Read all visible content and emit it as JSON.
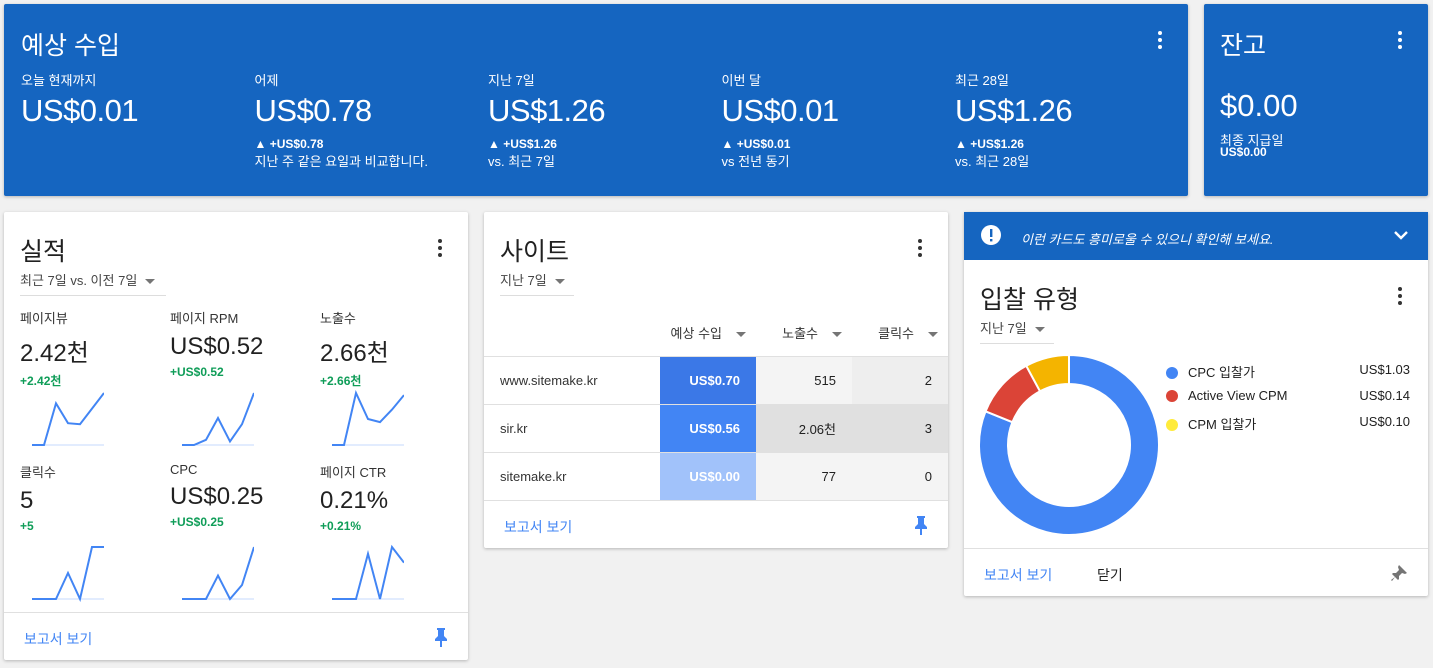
{
  "earnings": {
    "title": "예상 수입",
    "stats": [
      {
        "label": "오늘 현재까지",
        "value": "US$0.01",
        "delta": "",
        "sub": ""
      },
      {
        "label": "어제",
        "value": "US$0.78",
        "delta": "▲ +US$0.78",
        "sub": "지난 주 같은 요일과 비교합니다."
      },
      {
        "label": "지난 7일",
        "value": "US$1.26",
        "delta": "▲ +US$1.26",
        "sub": "vs. 최근 7일"
      },
      {
        "label": "이번 달",
        "value": "US$0.01",
        "delta": "▲ +US$0.01",
        "sub": "vs 전년 동기"
      },
      {
        "label": "최근 28일",
        "value": "US$1.26",
        "delta": "▲ +US$1.26",
        "sub": "vs. 최근 28일"
      }
    ]
  },
  "balance": {
    "title": "잔고",
    "value": "$0.00",
    "label": "최종 지급일",
    "amount": "US$0.00"
  },
  "performance": {
    "title": "실적",
    "range": "최근 7일 vs. 이전 7일",
    "report": "보고서 보기",
    "metrics": [
      {
        "label": "페이지뷰",
        "value": "2.42천",
        "delta": "+2.42천",
        "trend": [
          0,
          0,
          0.8,
          0.42,
          0.4,
          0.7,
          1
        ]
      },
      {
        "label": "페이지 RPM",
        "value": "US$0.52",
        "delta": "+US$0.52",
        "trend": [
          0,
          0,
          0.1,
          0.52,
          0.07,
          0.4,
          1
        ]
      },
      {
        "label": "노출수",
        "value": "2.66천",
        "delta": "+2.66천",
        "trend": [
          0,
          0,
          1,
          0.5,
          0.44,
          0.68,
          0.96
        ]
      },
      {
        "label": "클릭수",
        "value": "5",
        "delta": "+5",
        "trend": [
          0,
          0,
          0,
          0.5,
          0,
          1,
          1
        ]
      },
      {
        "label": "CPC",
        "value": "US$0.25",
        "delta": "+US$0.25",
        "trend": [
          0,
          0,
          0,
          0.45,
          0,
          0.27,
          1
        ]
      },
      {
        "label": "페이지 CTR",
        "value": "0.21%",
        "delta": "+0.21%",
        "trend": [
          0,
          0,
          0,
          0.87,
          0,
          1,
          0.7
        ]
      }
    ]
  },
  "sites": {
    "title": "사이트",
    "range": "지난 7일",
    "report": "보고서 보기",
    "columns": [
      "예상 수입",
      "노출수",
      "클릭수"
    ],
    "rows": [
      {
        "site": "www.sitemake.kr",
        "earnings": "US$0.70",
        "impressions": "515",
        "clicks": "2"
      },
      {
        "site": "sir.kr",
        "earnings": "US$0.56",
        "impressions": "2.06천",
        "clicks": "3"
      },
      {
        "site": "sitemake.kr",
        "earnings": "US$0.00",
        "impressions": "77",
        "clicks": "0"
      }
    ]
  },
  "bid": {
    "banner": "이런 카드도 흥미로울 수 있으니 확인해 보세요.",
    "title": "입찰 유형",
    "range": "지난 7일",
    "report": "보고서 보기",
    "dismiss": "닫기"
  },
  "chart_data": {
    "type": "pie",
    "title": "입찰 유형",
    "categories": [
      "CPC 입찰가",
      "Active View CPM",
      "CPM 입찰가"
    ],
    "labels": [
      "US$1.03",
      "US$0.14",
      "US$0.10"
    ],
    "values": [
      1.03,
      0.14,
      0.1
    ],
    "colors": [
      "#4285f4",
      "#db4437",
      "#f4b400"
    ],
    "legend_colors": [
      "#4285f4",
      "#db4437",
      "#ffeb3b"
    ]
  }
}
